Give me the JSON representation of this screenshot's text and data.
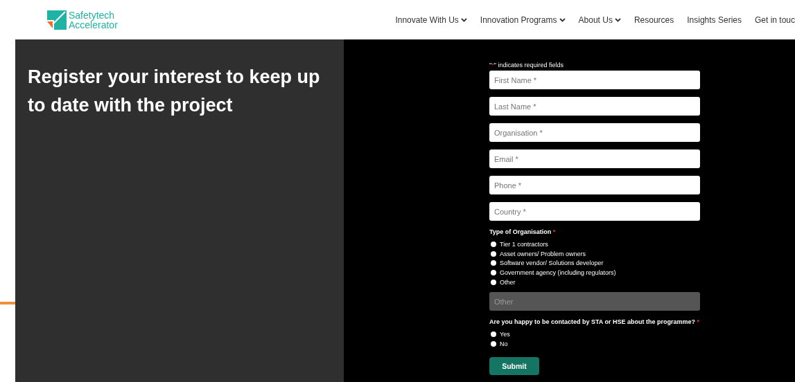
{
  "logo": {
    "line1": "Safetytech",
    "line2": "Accelerator"
  },
  "nav": [
    {
      "label": "Innovate With Us",
      "dropdown": true
    },
    {
      "label": "Innovation Programs",
      "dropdown": true
    },
    {
      "label": "About Us",
      "dropdown": true
    },
    {
      "label": "Resources",
      "dropdown": false
    },
    {
      "label": "Insights Series",
      "dropdown": false
    },
    {
      "label": "Get in touc",
      "dropdown": false
    }
  ],
  "heading": "Register your interest to keep up to date with the project",
  "form": {
    "required_note": {
      "open": "\"",
      "mark": "*",
      "close": "\" indicates required fields"
    },
    "fields": [
      {
        "placeholder": "First Name *"
      },
      {
        "placeholder": "Last Name *"
      },
      {
        "placeholder": "Organisation *"
      },
      {
        "placeholder": "Email *"
      },
      {
        "placeholder": "Phone *"
      },
      {
        "placeholder": "Country *"
      }
    ],
    "organisation_type": {
      "label": "Type of Organisation",
      "mark": "*",
      "options": [
        {
          "label": "Tier 1 contractors",
          "selected": false
        },
        {
          "label": "Asset owners/ Problem owners",
          "selected": false
        },
        {
          "label": "Software vendor/ Solutions developer",
          "selected": false
        },
        {
          "label": "Government agency (including regulators)",
          "selected": false
        },
        {
          "label": "Other",
          "selected": false
        }
      ]
    },
    "other_field": {
      "placeholder": "Other",
      "disabled": true
    },
    "contact": {
      "label": "Are you happy to be contacted by STA or HSE about the programme?",
      "mark": "*",
      "options": [
        {
          "label": "Yes",
          "selected": false
        },
        {
          "label": "No",
          "selected": false
        }
      ]
    },
    "submit": "Submit"
  }
}
